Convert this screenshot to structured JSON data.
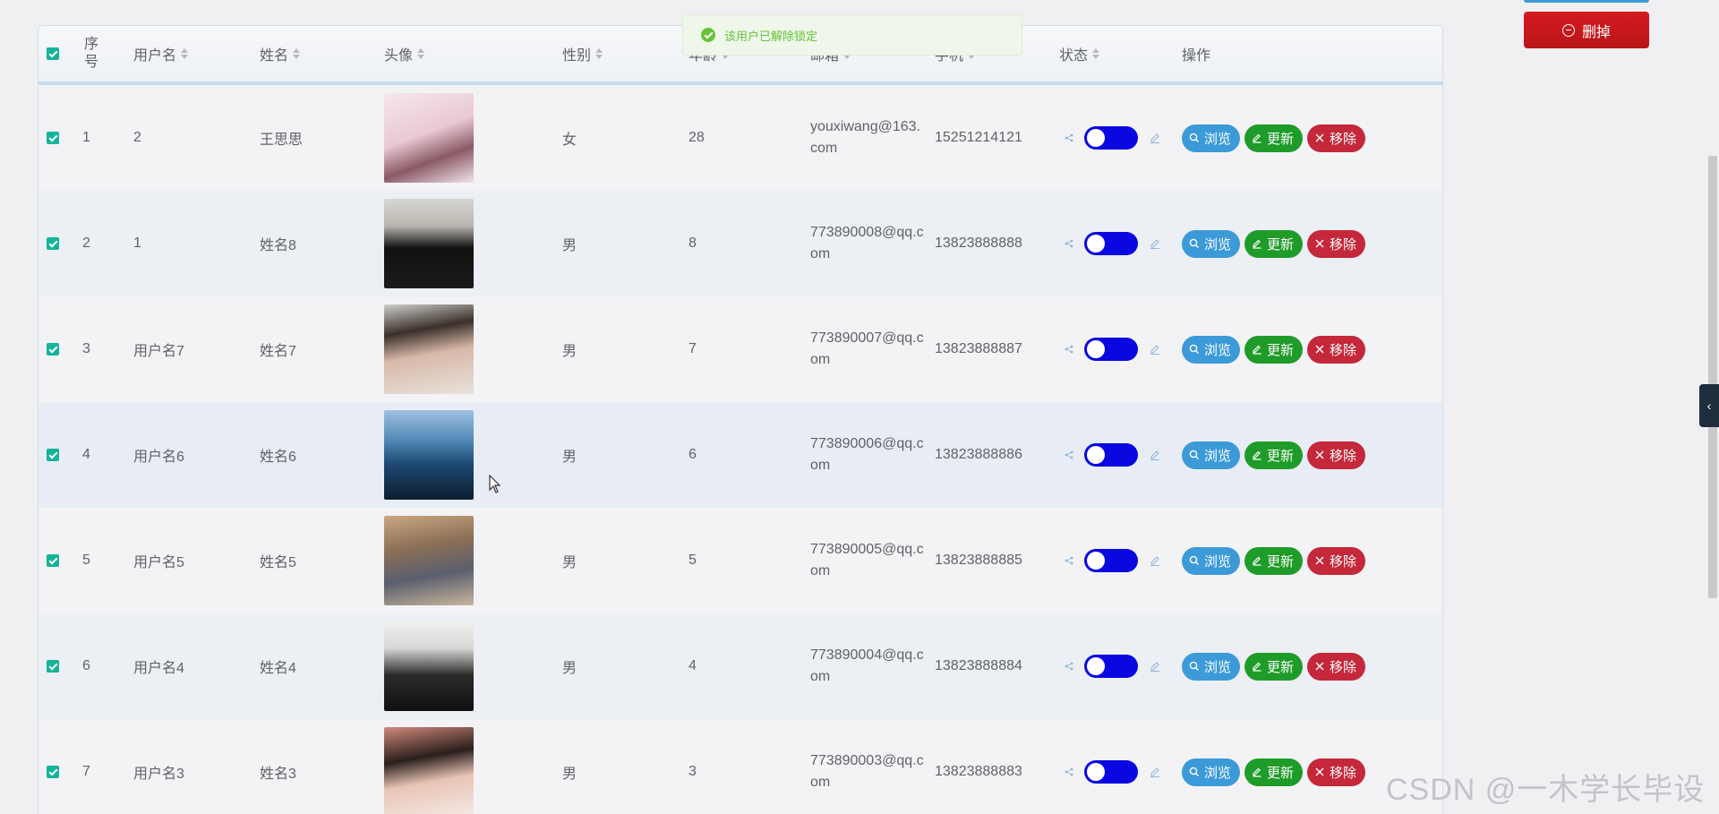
{
  "toast": {
    "message": "该用户已解除锁定"
  },
  "actions": {
    "delete_label": "删掉"
  },
  "table": {
    "headers": {
      "no": "序号",
      "username": "用户名",
      "name": "姓名",
      "avatar": "头像",
      "sex": "性别",
      "age": "年龄",
      "email": "邮箱",
      "phone": "手机",
      "status": "状态",
      "ops": "操作"
    },
    "rows": [
      {
        "no": "1",
        "username": "2",
        "name": "王思思",
        "sex": "女",
        "age": "28",
        "email": "youxiwang@163.com",
        "phone": "15251214121"
      },
      {
        "no": "2",
        "username": "1",
        "name": "姓名8",
        "sex": "男",
        "age": "8",
        "email": "773890008@qq.com",
        "phone": "13823888888"
      },
      {
        "no": "3",
        "username": "用户名7",
        "name": "姓名7",
        "sex": "男",
        "age": "7",
        "email": "773890007@qq.com",
        "phone": "13823888887"
      },
      {
        "no": "4",
        "username": "用户名6",
        "name": "姓名6",
        "sex": "男",
        "age": "6",
        "email": "773890006@qq.com",
        "phone": "13823888886"
      },
      {
        "no": "5",
        "username": "用户名5",
        "name": "姓名5",
        "sex": "男",
        "age": "5",
        "email": "773890005@qq.com",
        "phone": "13823888885"
      },
      {
        "no": "6",
        "username": "用户名4",
        "name": "姓名4",
        "sex": "男",
        "age": "4",
        "email": "773890004@qq.com",
        "phone": "13823888884"
      },
      {
        "no": "7",
        "username": "用户名3",
        "name": "姓名3",
        "sex": "男",
        "age": "3",
        "email": "773890003@qq.com",
        "phone": "13823888883"
      }
    ],
    "row_buttons": {
      "view": "浏览",
      "edit": "更新",
      "remove": "移除"
    }
  },
  "watermark": "CSDN @一木学长毕设",
  "colors": {
    "toggle_on": "#0a07e0",
    "view": "#3c9ad8",
    "edit": "#1f9b29",
    "remove": "#c4283a",
    "check": "#14b39a"
  }
}
